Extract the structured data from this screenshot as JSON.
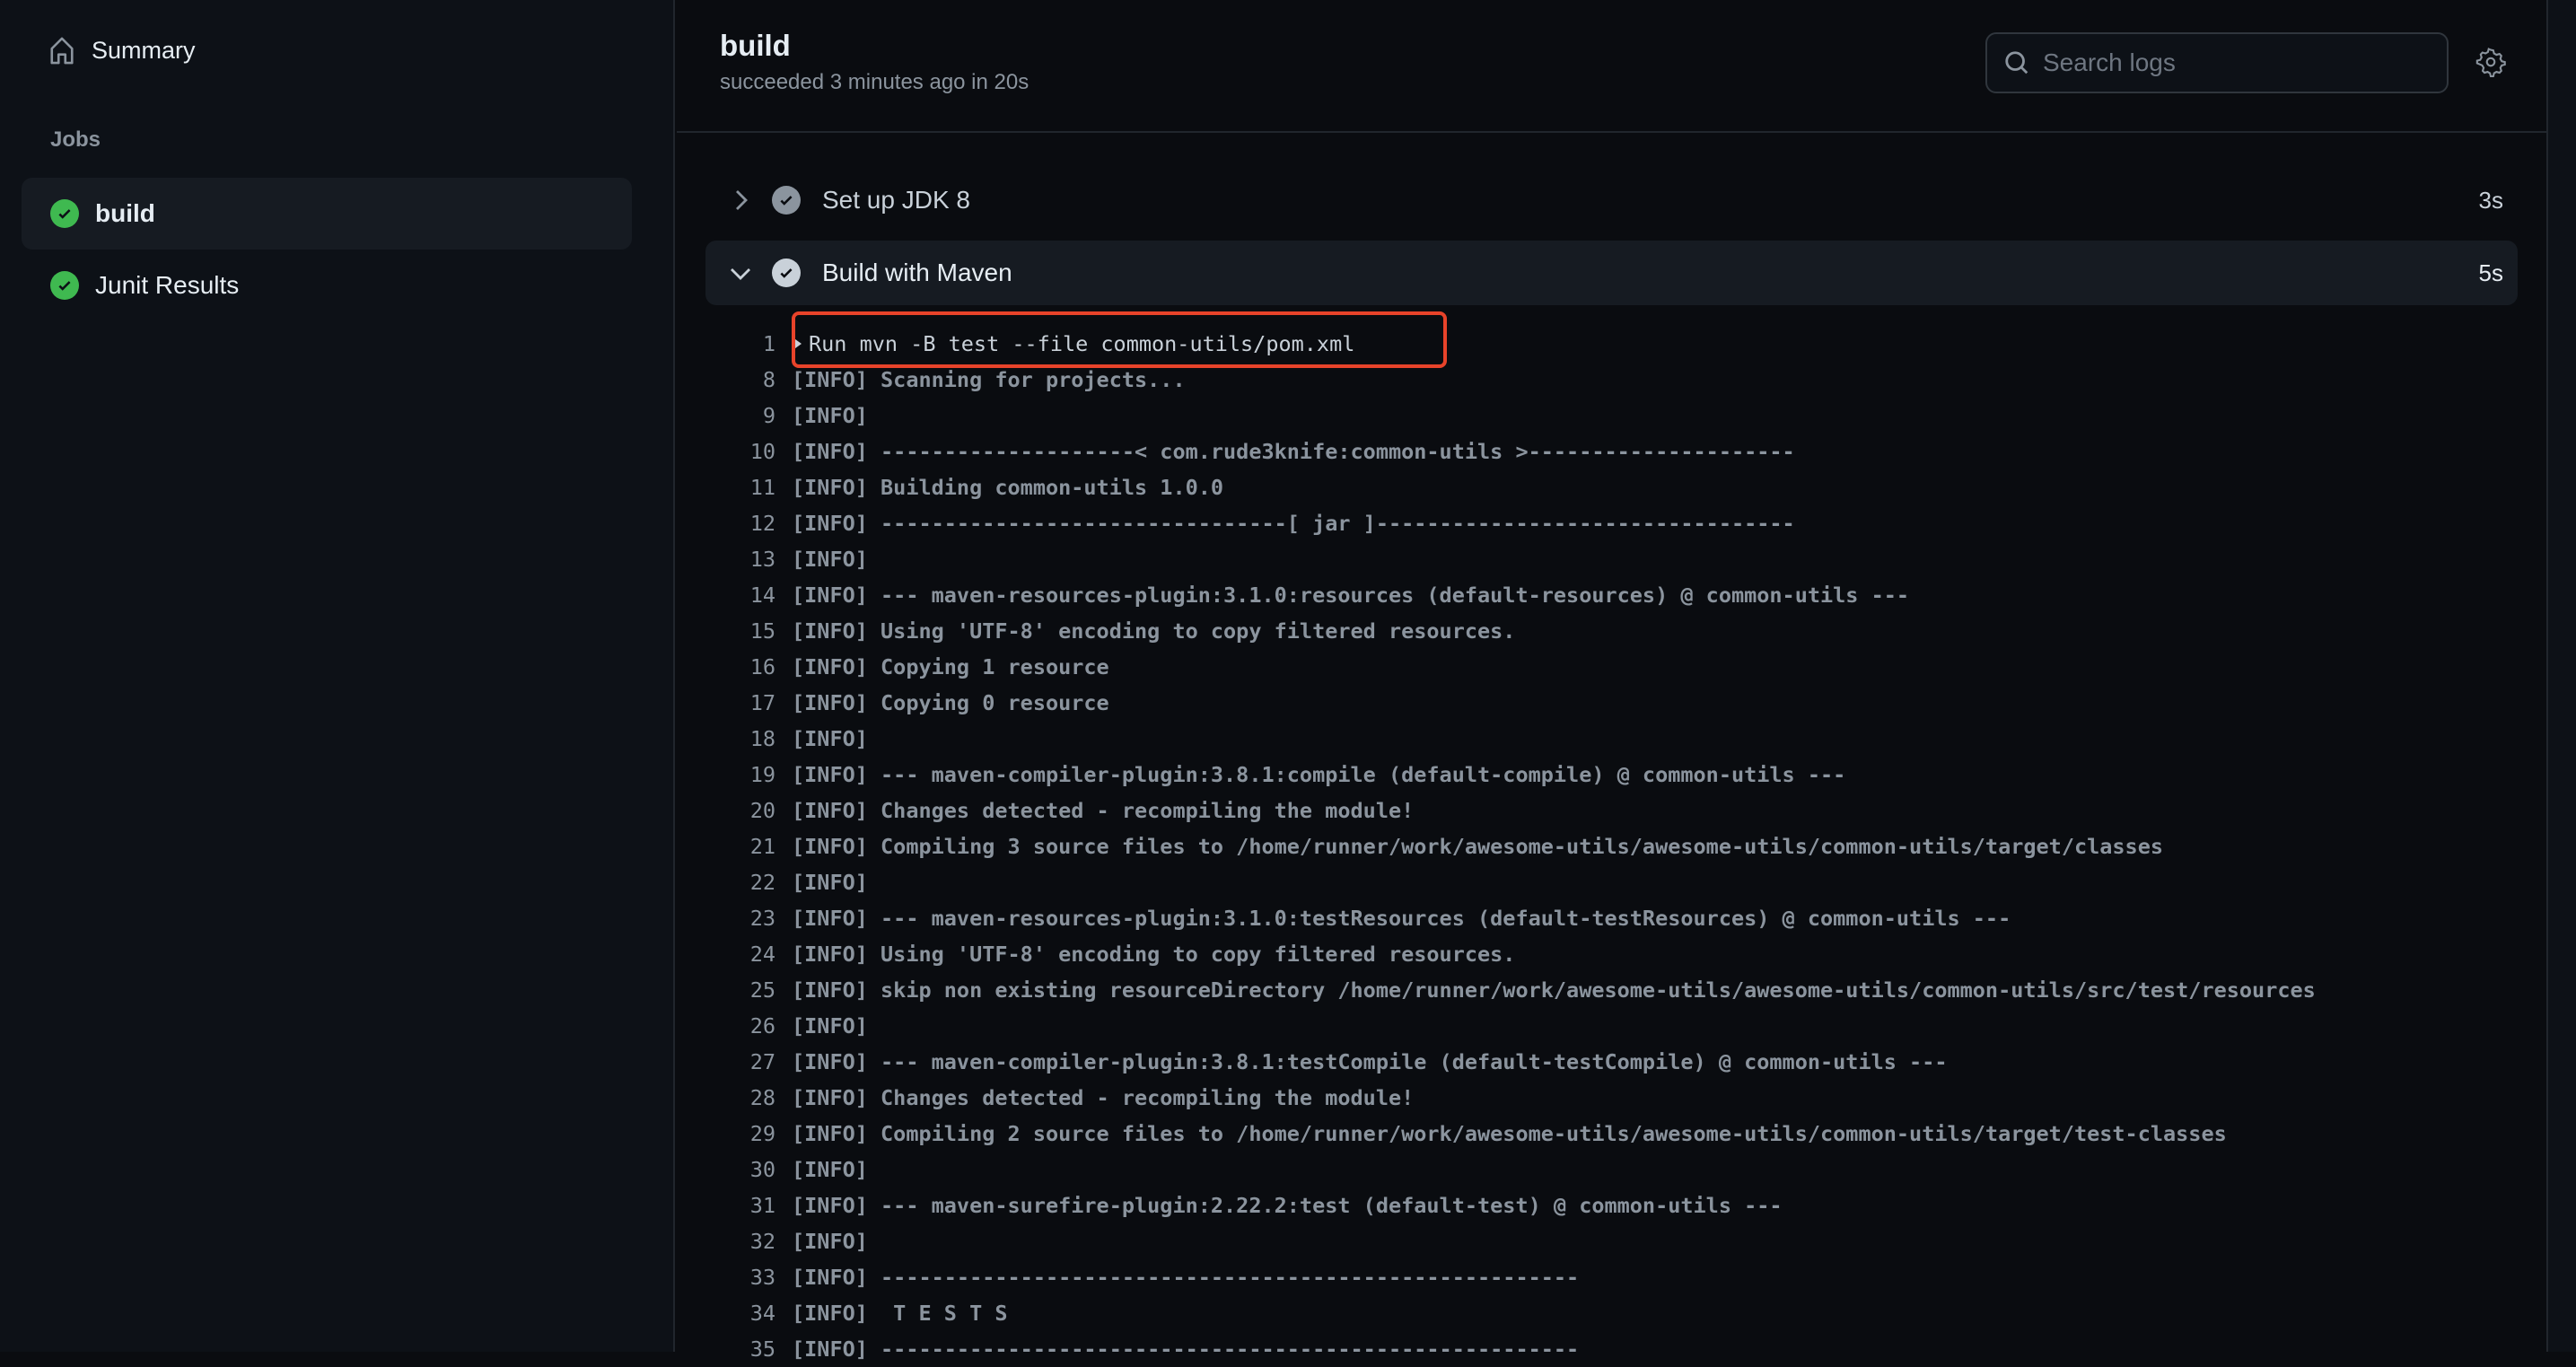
{
  "sidebar": {
    "summary": "Summary",
    "jobs_heading": "Jobs",
    "jobs": [
      {
        "label": "build",
        "status": "success",
        "active": true
      },
      {
        "label": "Junit Results",
        "status": "success",
        "active": false
      }
    ]
  },
  "header": {
    "title": "build",
    "subtitle": "succeeded 3 minutes ago in 20s",
    "search_placeholder": "Search logs"
  },
  "steps": [
    {
      "label": "Set up JDK 8",
      "duration": "3s",
      "expanded": false
    },
    {
      "label": "Build with Maven",
      "duration": "5s",
      "expanded": true
    }
  ],
  "colors": {
    "success": "#3fb950",
    "highlight_box": "#e8432a"
  },
  "log": [
    {
      "n": "1",
      "t": "Run mvn -B test --file common-utils/pom.xml",
      "group": true
    },
    {
      "n": "8",
      "t": "[INFO] Scanning for projects..."
    },
    {
      "n": "9",
      "t": "[INFO]"
    },
    {
      "n": "10",
      "t": "[INFO] --------------------< com.rude3knife:common-utils >---------------------"
    },
    {
      "n": "11",
      "t": "[INFO] Building common-utils 1.0.0"
    },
    {
      "n": "12",
      "t": "[INFO] --------------------------------[ jar ]---------------------------------"
    },
    {
      "n": "13",
      "t": "[INFO]"
    },
    {
      "n": "14",
      "t": "[INFO] --- maven-resources-plugin:3.1.0:resources (default-resources) @ common-utils ---"
    },
    {
      "n": "15",
      "t": "[INFO] Using 'UTF-8' encoding to copy filtered resources."
    },
    {
      "n": "16",
      "t": "[INFO] Copying 1 resource"
    },
    {
      "n": "17",
      "t": "[INFO] Copying 0 resource"
    },
    {
      "n": "18",
      "t": "[INFO]"
    },
    {
      "n": "19",
      "t": "[INFO] --- maven-compiler-plugin:3.8.1:compile (default-compile) @ common-utils ---"
    },
    {
      "n": "20",
      "t": "[INFO] Changes detected - recompiling the module!"
    },
    {
      "n": "21",
      "t": "[INFO] Compiling 3 source files to /home/runner/work/awesome-utils/awesome-utils/common-utils/target/classes"
    },
    {
      "n": "22",
      "t": "[INFO]"
    },
    {
      "n": "23",
      "t": "[INFO] --- maven-resources-plugin:3.1.0:testResources (default-testResources) @ common-utils ---"
    },
    {
      "n": "24",
      "t": "[INFO] Using 'UTF-8' encoding to copy filtered resources."
    },
    {
      "n": "25",
      "t": "[INFO] skip non existing resourceDirectory /home/runner/work/awesome-utils/awesome-utils/common-utils/src/test/resources"
    },
    {
      "n": "26",
      "t": "[INFO]"
    },
    {
      "n": "27",
      "t": "[INFO] --- maven-compiler-plugin:3.8.1:testCompile (default-testCompile) @ common-utils ---"
    },
    {
      "n": "28",
      "t": "[INFO] Changes detected - recompiling the module!"
    },
    {
      "n": "29",
      "t": "[INFO] Compiling 2 source files to /home/runner/work/awesome-utils/awesome-utils/common-utils/target/test-classes"
    },
    {
      "n": "30",
      "t": "[INFO]"
    },
    {
      "n": "31",
      "t": "[INFO] --- maven-surefire-plugin:2.22.2:test (default-test) @ common-utils ---"
    },
    {
      "n": "32",
      "t": "[INFO]"
    },
    {
      "n": "33",
      "t": "[INFO] -------------------------------------------------------"
    },
    {
      "n": "34",
      "t": "[INFO]  T E S T S"
    },
    {
      "n": "35",
      "t": "[INFO] -------------------------------------------------------"
    }
  ]
}
